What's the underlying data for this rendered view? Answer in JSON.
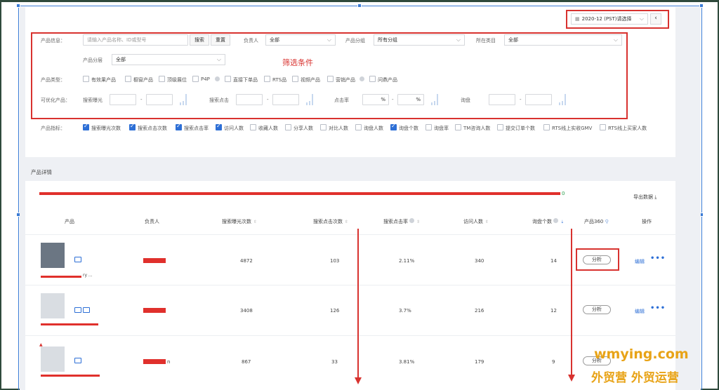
{
  "top": {
    "date_picker_value": "2020-12 (PST)请选择",
    "prev_icon": "chevron-left-icon"
  },
  "filters": {
    "product_info_label": "产品信息：",
    "product_info_placeholder": "请输入产品名称、ID或型号",
    "search_button": "搜索",
    "reset_button": "重置",
    "owner_label": "负责人",
    "owner_value": "全部",
    "group_label": "产品分组",
    "group_value": "所有分组",
    "category_label": "所在类目",
    "category_value": "全部",
    "tier_label": "产品分层",
    "tier_value": "全部",
    "annotation": "筛选条件",
    "type_label": "产品类型：",
    "types": [
      "有效果产品",
      "橱窗产品",
      "顶级展位",
      "P4P",
      "直接下单品",
      "RTS品",
      "视频产品",
      "营销产品",
      "问鼎产品"
    ],
    "optimizable_label": "可优化产品：",
    "exposure_label": "搜索曝光",
    "clicks_label": "搜索点击",
    "ctr_label": "点击率",
    "pct": "%",
    "inquiry_label": "询盘",
    "dash": "-"
  },
  "metrics": {
    "label": "产品指标：",
    "items": [
      {
        "label": "搜索曝光次数",
        "checked": true
      },
      {
        "label": "搜索点击次数",
        "checked": true
      },
      {
        "label": "搜索点击率",
        "checked": true
      },
      {
        "label": "访问人数",
        "checked": true
      },
      {
        "label": "收藏人数",
        "checked": false
      },
      {
        "label": "分享人数",
        "checked": false
      },
      {
        "label": "对比人数",
        "checked": false
      },
      {
        "label": "询盘人数",
        "checked": false
      },
      {
        "label": "询盘个数",
        "checked": true
      },
      {
        "label": "询盘率",
        "checked": false
      },
      {
        "label": "TM咨询人数",
        "checked": false
      },
      {
        "label": "提交订单个数",
        "checked": false
      },
      {
        "label": "RTS线上实收GMV",
        "checked": false
      },
      {
        "label": "RTS线上买家人数",
        "checked": false
      }
    ]
  },
  "details": {
    "section_title": "产品详情",
    "export_label": "导出数据",
    "count_suffix": "0",
    "columns": [
      "产品",
      "负责人",
      "搜索曝光次数",
      "搜索点击次数",
      "搜索点击率",
      "访问人数",
      "询盘个数",
      "产品360",
      "操作"
    ],
    "rows": [
      {
        "product_caption": "ry ...",
        "exposure": "4872",
        "clicks": "103",
        "ctr": "2.11%",
        "visitors": "340",
        "inquiries": "14",
        "analyze": "分析",
        "edit": "编辑"
      },
      {
        "product_caption": "",
        "exposure": "3408",
        "clicks": "126",
        "ctr": "3.7%",
        "visitors": "216",
        "inquiries": "12",
        "analyze": "分析",
        "edit": "编辑"
      },
      {
        "product_caption": "",
        "exposure": "867",
        "clicks": "33",
        "ctr": "3.81%",
        "visitors": "179",
        "inquiries": "9",
        "analyze": "分析",
        "edit": "",
        "owner_suffix": "n"
      }
    ],
    "more_icon": "more-dots-icon"
  },
  "watermark": {
    "line1": "wmying.com",
    "line2": "外贸营 外贸运营"
  },
  "colors": {
    "accent": "#2d6fd6",
    "annotation_red": "#d8322f",
    "watermark": "#e8a317"
  }
}
